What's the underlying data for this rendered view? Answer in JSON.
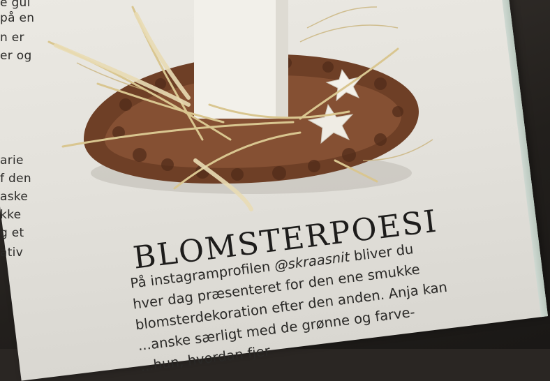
{
  "left_column": [
    "e gul",
    "på en",
    "n er",
    "er og",
    "arie",
    "f den",
    "aske",
    "kke",
    "g et",
    "ativ"
  ],
  "headline": "BLOMSTERPOESI",
  "body": {
    "line1_before": "På instagramprofilen ",
    "handle": "@skraasnit",
    "line1_after": " bliver du",
    "line2": "hver dag præsenteret for den ene smukke",
    "line3": "blomsterdekoration efter den anden. Anja kan",
    "line4": "...anske særligt med de grønne og farve-",
    "line5": "...hun, hvordan fjer"
  },
  "colors": {
    "paper": "#e6e4de",
    "ink": "#2a2927",
    "table": "#2a2623",
    "wreath": "#7a4a2e",
    "candle": "#f1efe9",
    "grass": "#d8c48a"
  }
}
